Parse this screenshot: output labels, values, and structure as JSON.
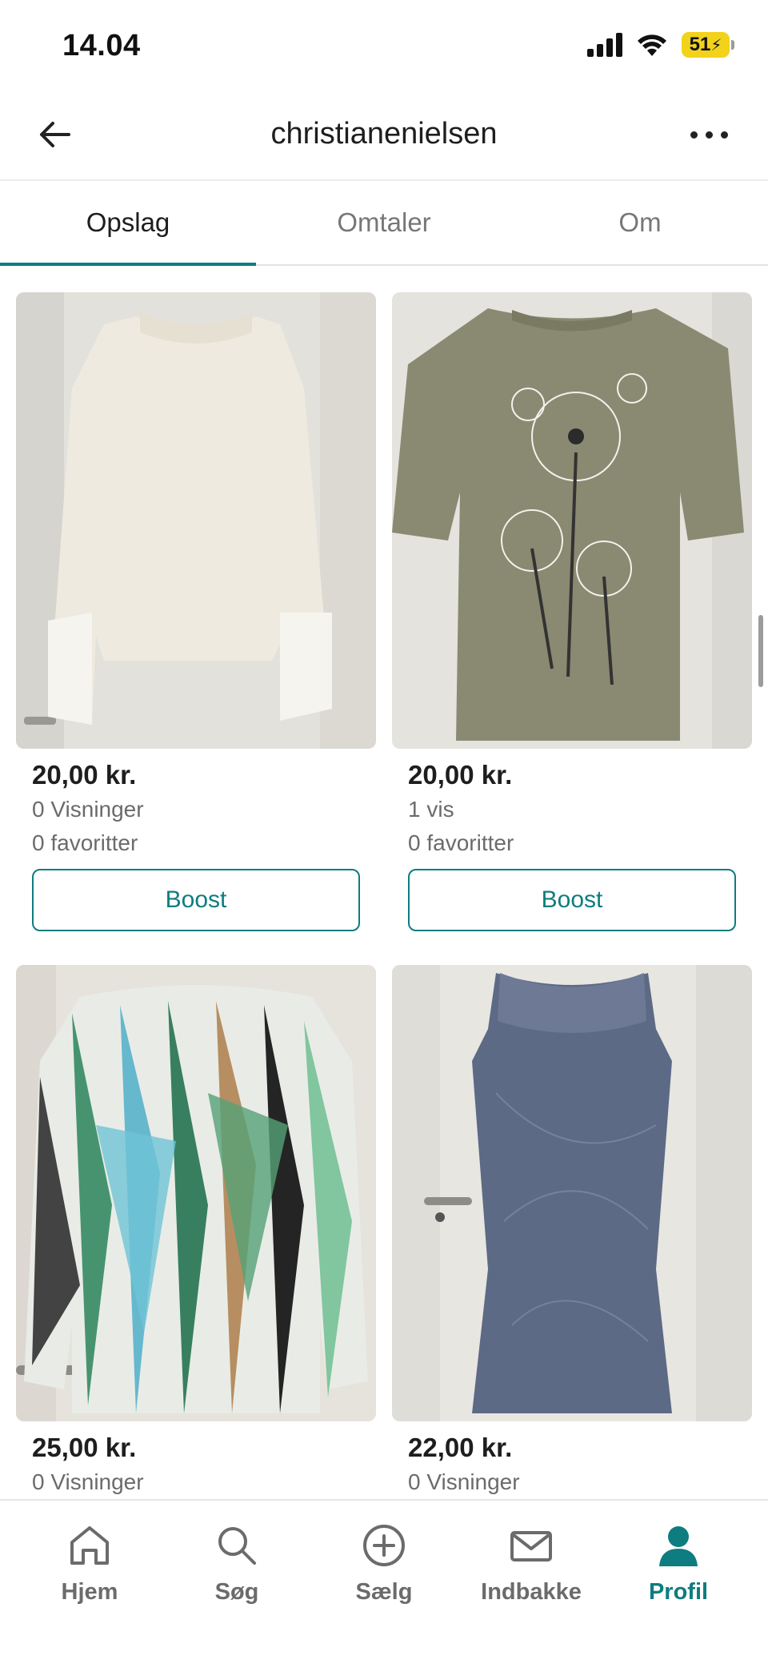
{
  "status_bar": {
    "time": "14.04",
    "battery": "51"
  },
  "header": {
    "title": "christianenielsen"
  },
  "tabs": [
    {
      "label": "Opslag",
      "active": true
    },
    {
      "label": "Omtaler",
      "active": false
    },
    {
      "label": "Om",
      "active": false
    }
  ],
  "listings": [
    {
      "price": "20,00 kr.",
      "views": "0 Visninger",
      "favorites": "0 favoritter",
      "boost": "Boost"
    },
    {
      "price": "20,00 kr.",
      "views": "1 vis",
      "favorites": "0 favoritter",
      "boost": "Boost"
    },
    {
      "price": "25,00 kr.",
      "views": "0 Visninger"
    },
    {
      "price": "22,00 kr.",
      "views": "0 Visninger"
    }
  ],
  "nav": [
    {
      "label": "Hjem",
      "icon": "home-icon"
    },
    {
      "label": "Søg",
      "icon": "search-icon"
    },
    {
      "label": "Sælg",
      "icon": "plus-circle-icon"
    },
    {
      "label": "Indbakke",
      "icon": "mail-icon"
    },
    {
      "label": "Profil",
      "icon": "profile-icon",
      "active": true
    }
  ],
  "colors": {
    "accent": "#0e7d80",
    "text": "#1e1e1e",
    "muted": "#6b6b6b"
  }
}
